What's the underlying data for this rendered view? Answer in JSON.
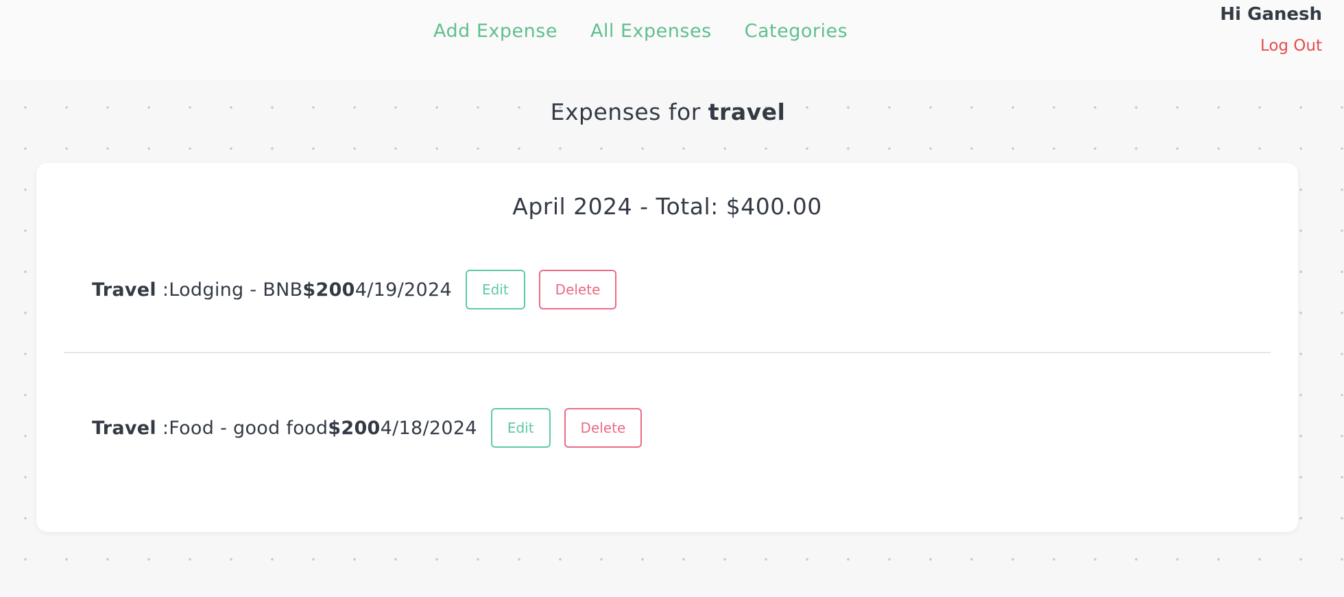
{
  "nav": {
    "items": [
      {
        "label": "Add Expense"
      },
      {
        "label": "All Expenses"
      },
      {
        "label": "Categories"
      }
    ]
  },
  "user": {
    "greeting": "Hi Ganesh",
    "logout_label": "Log Out"
  },
  "page": {
    "heading_prefix": "Expenses for",
    "category": "travel"
  },
  "summary": {
    "month": "April 2024",
    "separator": " - Total: ",
    "total": "$400.00"
  },
  "expenses": [
    {
      "category": "Travel",
      "separator": " :",
      "description": "Lodging - BNB",
      "amount": "$200",
      "date": "4/19/2024",
      "edit_label": "Edit",
      "delete_label": "Delete"
    },
    {
      "category": "Travel",
      "separator": " :",
      "description": "Food - good food",
      "amount": "$200",
      "date": "4/18/2024",
      "edit_label": "Edit",
      "delete_label": "Delete"
    }
  ],
  "colors": {
    "nav_link": "#5fbf8e",
    "logout": "#e54b4b",
    "edit": "#5cc8a9",
    "delete": "#ea6a84",
    "text": "#333a44"
  }
}
